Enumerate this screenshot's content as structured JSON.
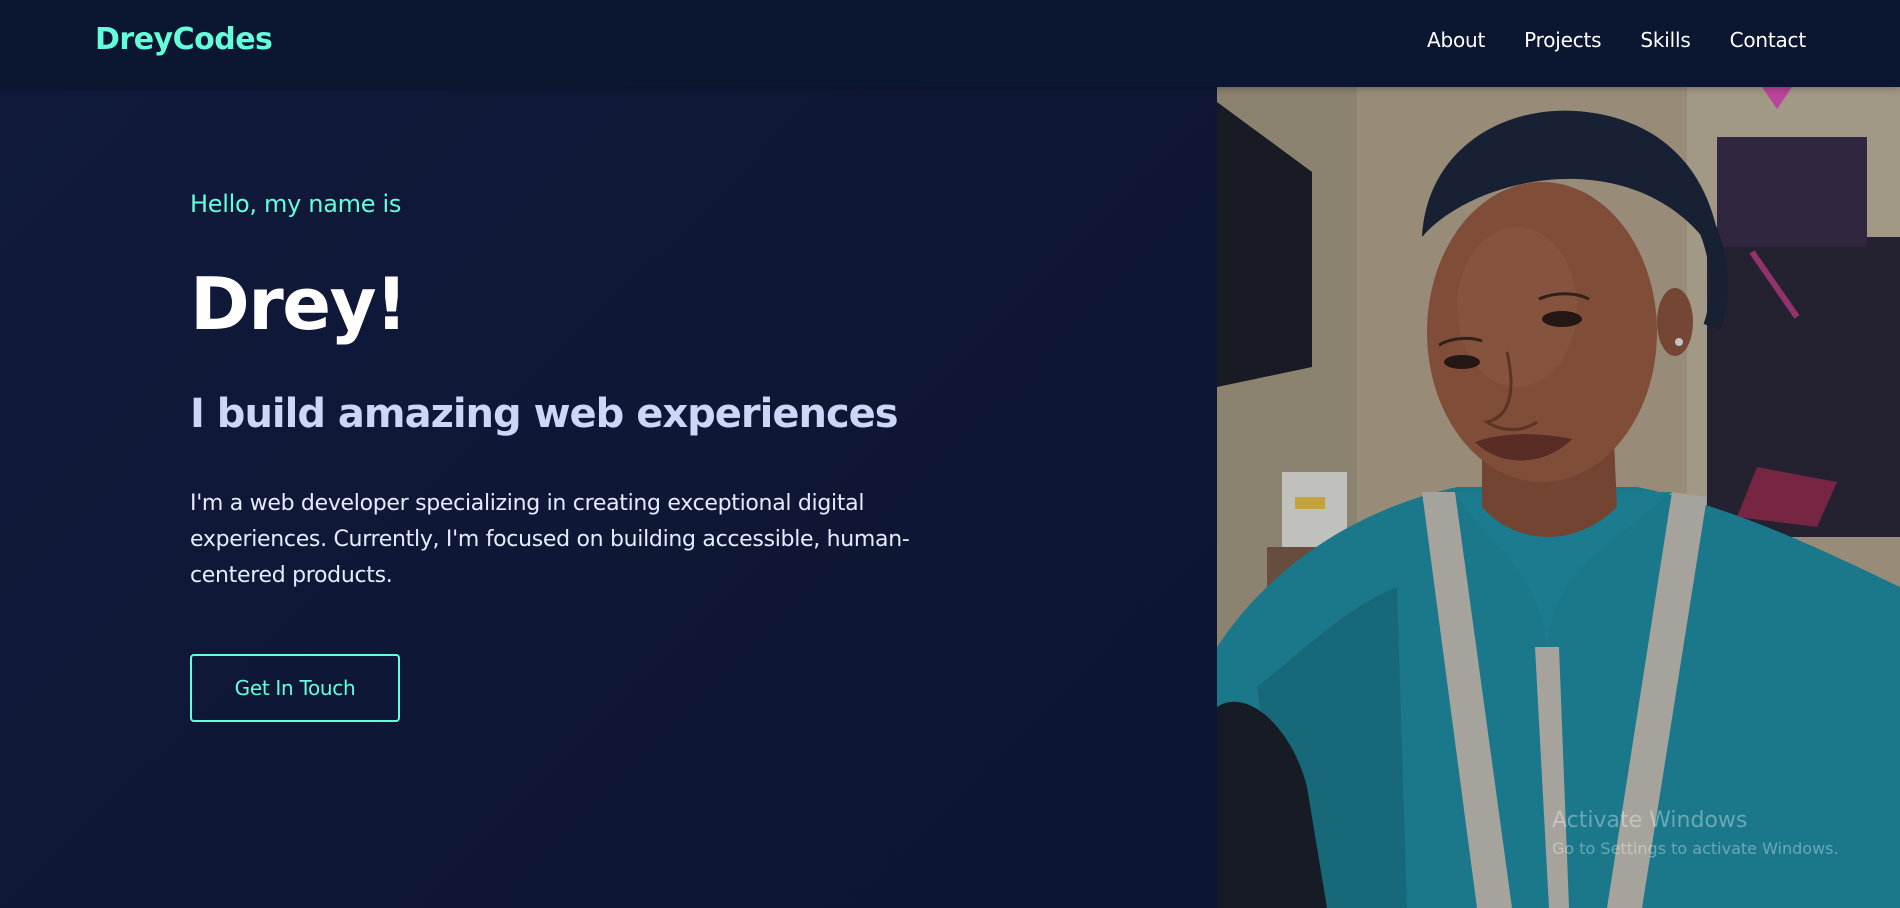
{
  "header": {
    "logo": "DreyCodes",
    "nav": [
      "About",
      "Projects",
      "Skills",
      "Contact"
    ]
  },
  "hero": {
    "greeting": "Hello, my name is",
    "name": "Drey!",
    "tagline": "I build amazing web experiences",
    "bio": "I'm a web developer specializing in creating exceptional digital experiences. Currently, I'm focused on building accessible, human-centered products.",
    "cta_label": "Get In Touch"
  },
  "watermark": {
    "title": "Activate Windows",
    "subtitle": "Go to Settings to activate Windows."
  },
  "colors": {
    "background": "#0f1733",
    "header": "#0b1730",
    "accent": "#64ffda",
    "heading": "#ffffff",
    "tagline": "#ccd6f6"
  }
}
